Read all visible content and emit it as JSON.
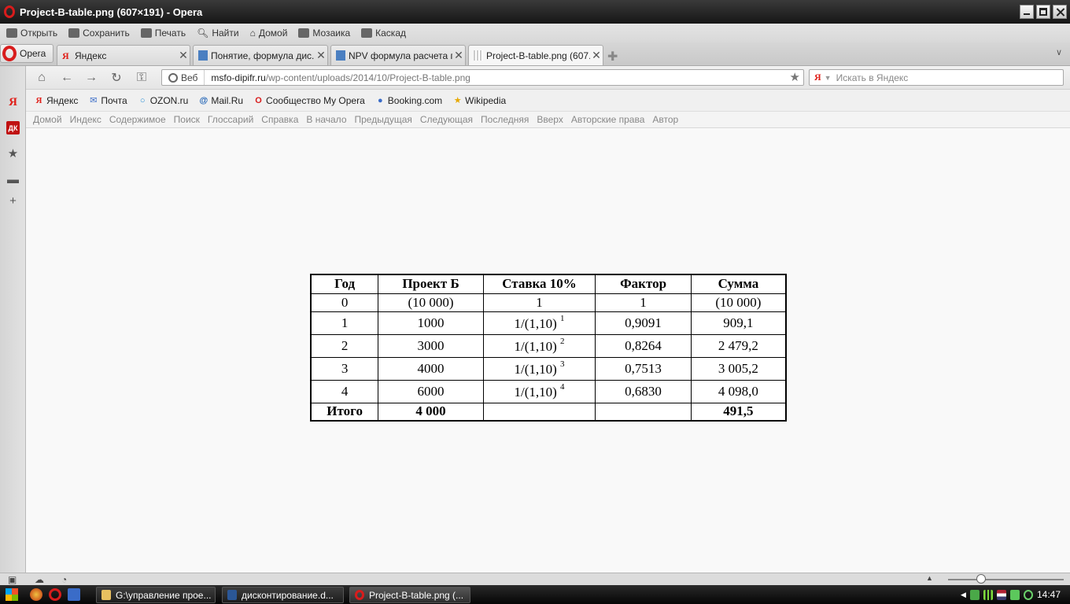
{
  "window": {
    "title": "Project-B-table.png (607×191) - Opera"
  },
  "menu": [
    "Открыть",
    "Сохранить",
    "Печать",
    "Найти",
    "Домой",
    "Мозаика",
    "Каскад"
  ],
  "opera_button": "Opera",
  "tabs": [
    {
      "label": "Яндекс"
    },
    {
      "label": "Понятие, формула дис..."
    },
    {
      "label": "NPV формула расчета п..."
    },
    {
      "label": "Project-B-table.png (607..."
    }
  ],
  "address": {
    "badge": "Веб",
    "host": "msfo-dipifr.ru",
    "path": "/wp-content/uploads/2014/10/Project-B-table.png"
  },
  "search": {
    "placeholder": "Искать в Яндекс"
  },
  "bookmarks": [
    "Яндекс",
    "Почта",
    "OZON.ru",
    "Mail.Ru",
    "Сообщество My Opera",
    "Booking.com",
    "Wikipedia"
  ],
  "nav_links": [
    "Домой",
    "Индекс",
    "Содержимое",
    "Поиск",
    "Глоссарий",
    "Справка",
    "В начало",
    "Предыдущая",
    "Следующая",
    "Последняя",
    "Вверх",
    "Авторские права",
    "Автор"
  ],
  "table": {
    "headers": [
      "Год",
      "Проект Б",
      "Ставка 10%",
      "Фактор",
      "Сумма"
    ],
    "rows": [
      {
        "year": "0",
        "project": "(10 000)",
        "rate": "1",
        "rate_exp": "",
        "factor": "1",
        "sum": "(10 000)"
      },
      {
        "year": "1",
        "project": "1000",
        "rate": "1/(1,10)",
        "rate_exp": "1",
        "factor": "0,9091",
        "sum": "909,1"
      },
      {
        "year": "2",
        "project": "3000",
        "rate": "1/(1,10)",
        "rate_exp": "2",
        "factor": "0,8264",
        "sum": "2 479,2"
      },
      {
        "year": "3",
        "project": "4000",
        "rate": "1/(1,10)",
        "rate_exp": "3",
        "factor": "0,7513",
        "sum": "3 005,2"
      },
      {
        "year": "4",
        "project": "6000",
        "rate": "1/(1,10)",
        "rate_exp": "4",
        "factor": "0,6830",
        "sum": "4 098,0"
      }
    ],
    "total": {
      "label": "Итого",
      "project": "4 000",
      "rate": "",
      "factor": "",
      "sum": "491,5"
    }
  },
  "taskbar": {
    "buttons": [
      "G:\\управление прое...",
      "дисконтирование.d...",
      "Project-B-table.png (..."
    ],
    "clock": "14:47"
  }
}
